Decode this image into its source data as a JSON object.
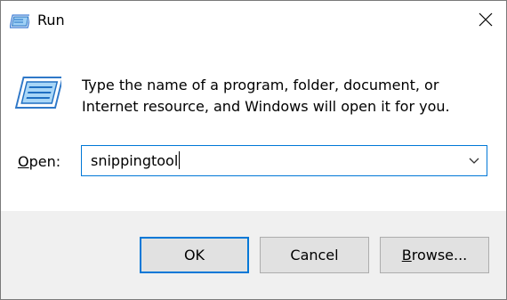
{
  "window": {
    "title": "Run",
    "title_icon": "run-icon",
    "close_icon": "close-icon"
  },
  "content": {
    "icon": "run-icon",
    "prompt_text": "Type the name of a program, folder, document, or Internet resource, and Windows will open it for you.",
    "open_label_accel": "O",
    "open_label_rest": "pen:",
    "open_value": "snippingtool",
    "dropdown_icon": "chevron-down-icon"
  },
  "buttons": {
    "ok": "OK",
    "cancel": "Cancel",
    "browse_accel": "B",
    "browse_rest": "rowse..."
  },
  "colors": {
    "accent": "#0078d7",
    "footer_bg": "#f0f0f0",
    "button_bg": "#e1e1e1"
  }
}
